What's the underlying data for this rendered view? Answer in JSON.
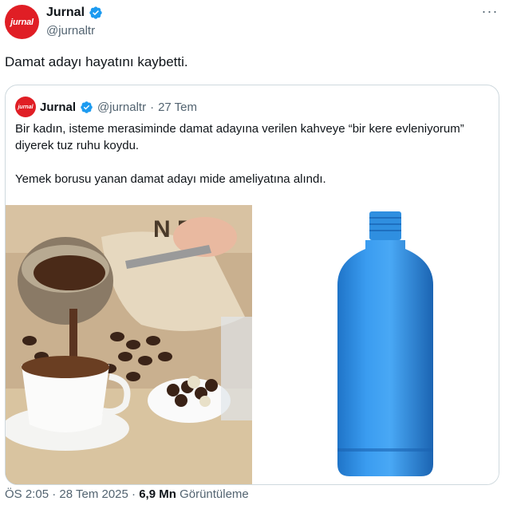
{
  "author": {
    "avatar_text": "jurnal",
    "display_name": "Jurnal",
    "handle": "@jurnaltr"
  },
  "tweet": {
    "text": "Damat adayı hayatını kaybetti."
  },
  "quote": {
    "avatar_text": "jurnal",
    "display_name": "Jurnal",
    "handle": "@jurnaltr",
    "separator": "·",
    "date": "27 Tem",
    "paragraph_1": "Bir kadın, isteme merasiminde damat adayına verilen kahveye “bir kere evleniyorum” diyerek tuz ruhu koydu.",
    "paragraph_2": "Yemek borusu yanan damat adayı mide ameliyatına alındı.",
    "images": [
      "turkish-coffee-photo",
      "blue-bottle-photo"
    ]
  },
  "footer": {
    "time": "ÖS 2:05",
    "separator": "·",
    "date": "28 Tem 2025",
    "views_count": "6,9 Mn",
    "views_label": "Görüntüleme"
  },
  "colors": {
    "brand_red": "#e01e25",
    "verified_blue": "#1d9bf0",
    "muted_text": "#536471",
    "bottle_blue": "#2f8fe0"
  }
}
